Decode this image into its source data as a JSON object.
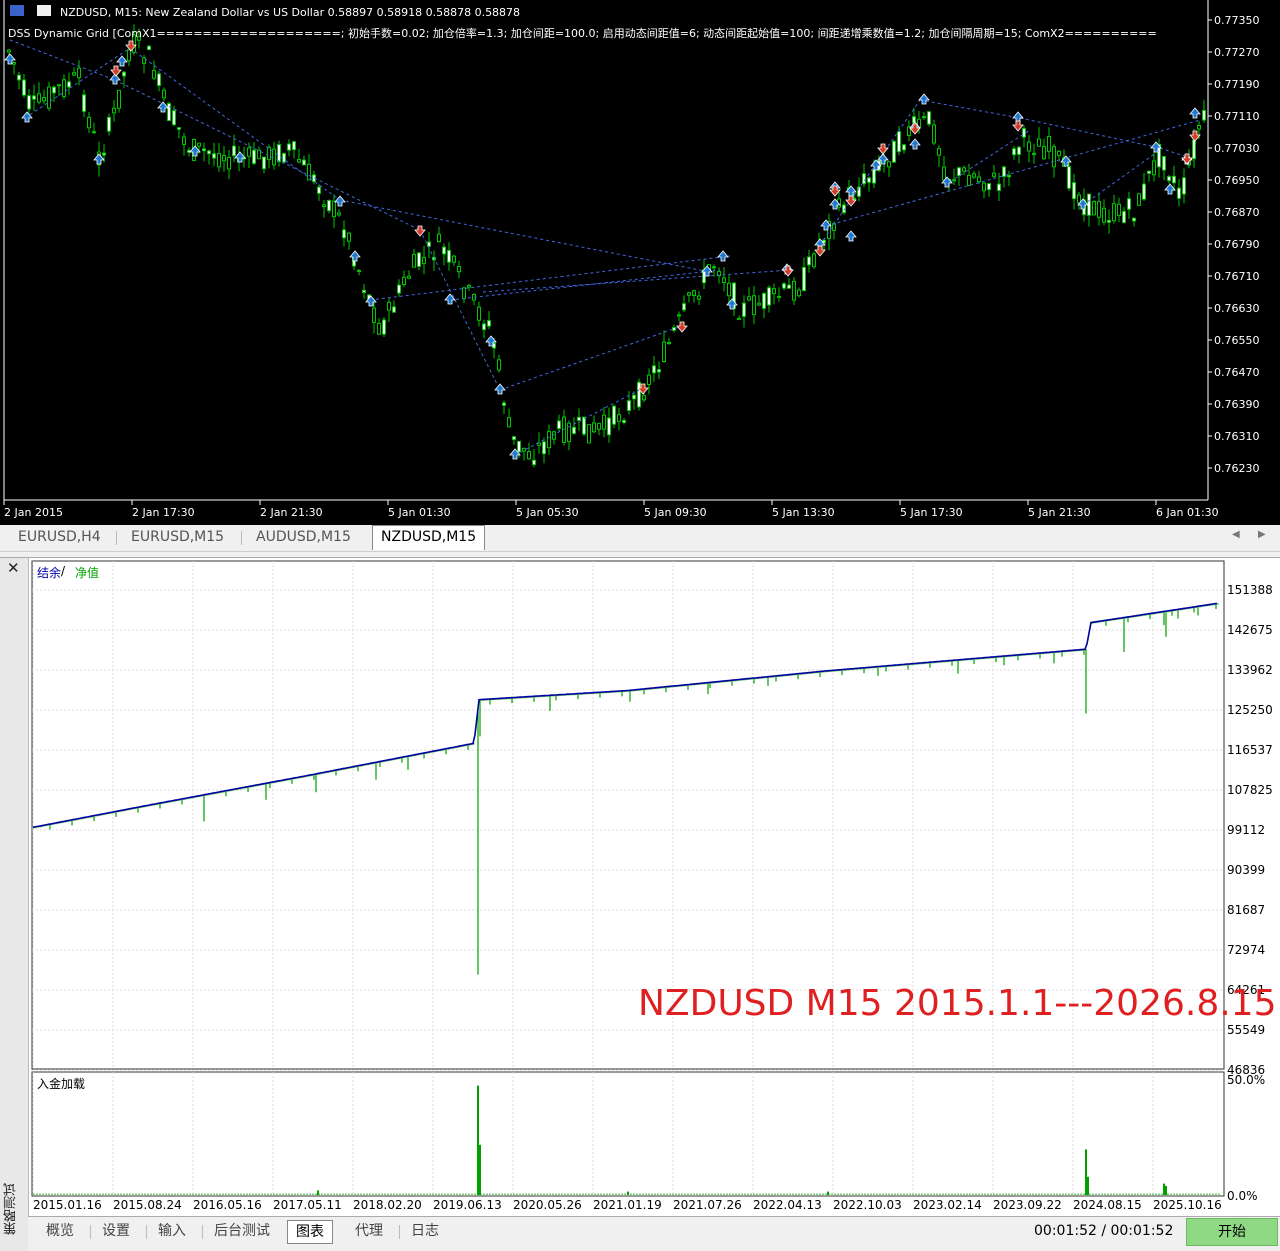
{
  "chart": {
    "symbol_line": "NZDUSD, M15:  New Zealand Dollar vs US Dollar  0.58897 0.58918 0.58878 0.58878",
    "indicator_line": "DSS Dynamic Grid [ComX1====================; 初始手数=0.02; 加仓倍率=1.3; 加仓间距=100.0; 启用动态间距值=6; 动态间距起始值=100; 间距递增乘数值=1.2; 加仓间隔周期=15; ComX2==========",
    "background": "#000000",
    "bull_color": "#ffffff",
    "wick_color": "#00c800",
    "buy_arrow_color": "#1e78d2",
    "sell_arrow_color": "#d23c28",
    "line_color": "#4169e1",
    "price_labels": [
      "0.77350",
      "0.77270",
      "0.77190",
      "0.77110",
      "0.77030",
      "0.76950",
      "0.76870",
      "0.76790",
      "0.76710",
      "0.76630",
      "0.76550",
      "0.76470",
      "0.76390",
      "0.76310",
      "0.76230"
    ],
    "time_labels": [
      "2 Jan 2015",
      "2 Jan 17:30",
      "2 Jan 21:30",
      "5 Jan 01:30",
      "5 Jan 05:30",
      "5 Jan 09:30",
      "5 Jan 13:30",
      "5 Jan 17:30",
      "5 Jan 21:30",
      "6 Jan 01:30"
    ]
  },
  "symbol_tabs": [
    {
      "label": "EURUSD,H4",
      "active": false
    },
    {
      "label": "EURUSD,M15",
      "active": false
    },
    {
      "label": "AUDUSD,M15",
      "active": false
    },
    {
      "label": "NZDUSD,M15",
      "active": true
    }
  ],
  "tester": {
    "side_title": "策略测试",
    "legend_balance": "结余",
    "legend_sep": " / ",
    "legend_equity": "净值",
    "balance_color": "#0000a0",
    "equity_color": "#00a000",
    "y_labels": [
      "151388",
      "142675",
      "133962",
      "125250",
      "116537",
      "107825",
      "99112",
      "90399",
      "81687",
      "72974",
      "64261",
      "55549",
      "46836"
    ],
    "x_labels": [
      "2015.01.16",
      "2015.08.24",
      "2016.05.16",
      "2017.05.11",
      "2018.02.20",
      "2019.06.13",
      "2020.05.26",
      "2021.01.19",
      "2021.07.26",
      "2022.04.13",
      "2022.10.03",
      "2023.02.14",
      "2023.09.22",
      "2024.08.15",
      "2025.10.16"
    ],
    "deposit_title": "入金加载",
    "deposit_top": "50.0%",
    "deposit_bottom": "0.0%",
    "watermark": "NZDUSD M15 2015.1.1---2026.8.15",
    "bottom_tabs": [
      {
        "label": "概览",
        "active": false
      },
      {
        "label": "设置",
        "active": false
      },
      {
        "label": "输入",
        "active": false
      },
      {
        "label": "后台测试",
        "active": false
      },
      {
        "label": "图表",
        "active": true
      },
      {
        "label": "代理",
        "active": false
      },
      {
        "label": "日志",
        "active": false
      }
    ],
    "time_display": "00:01:52 / 00:01:52",
    "start_label": "开始"
  }
}
